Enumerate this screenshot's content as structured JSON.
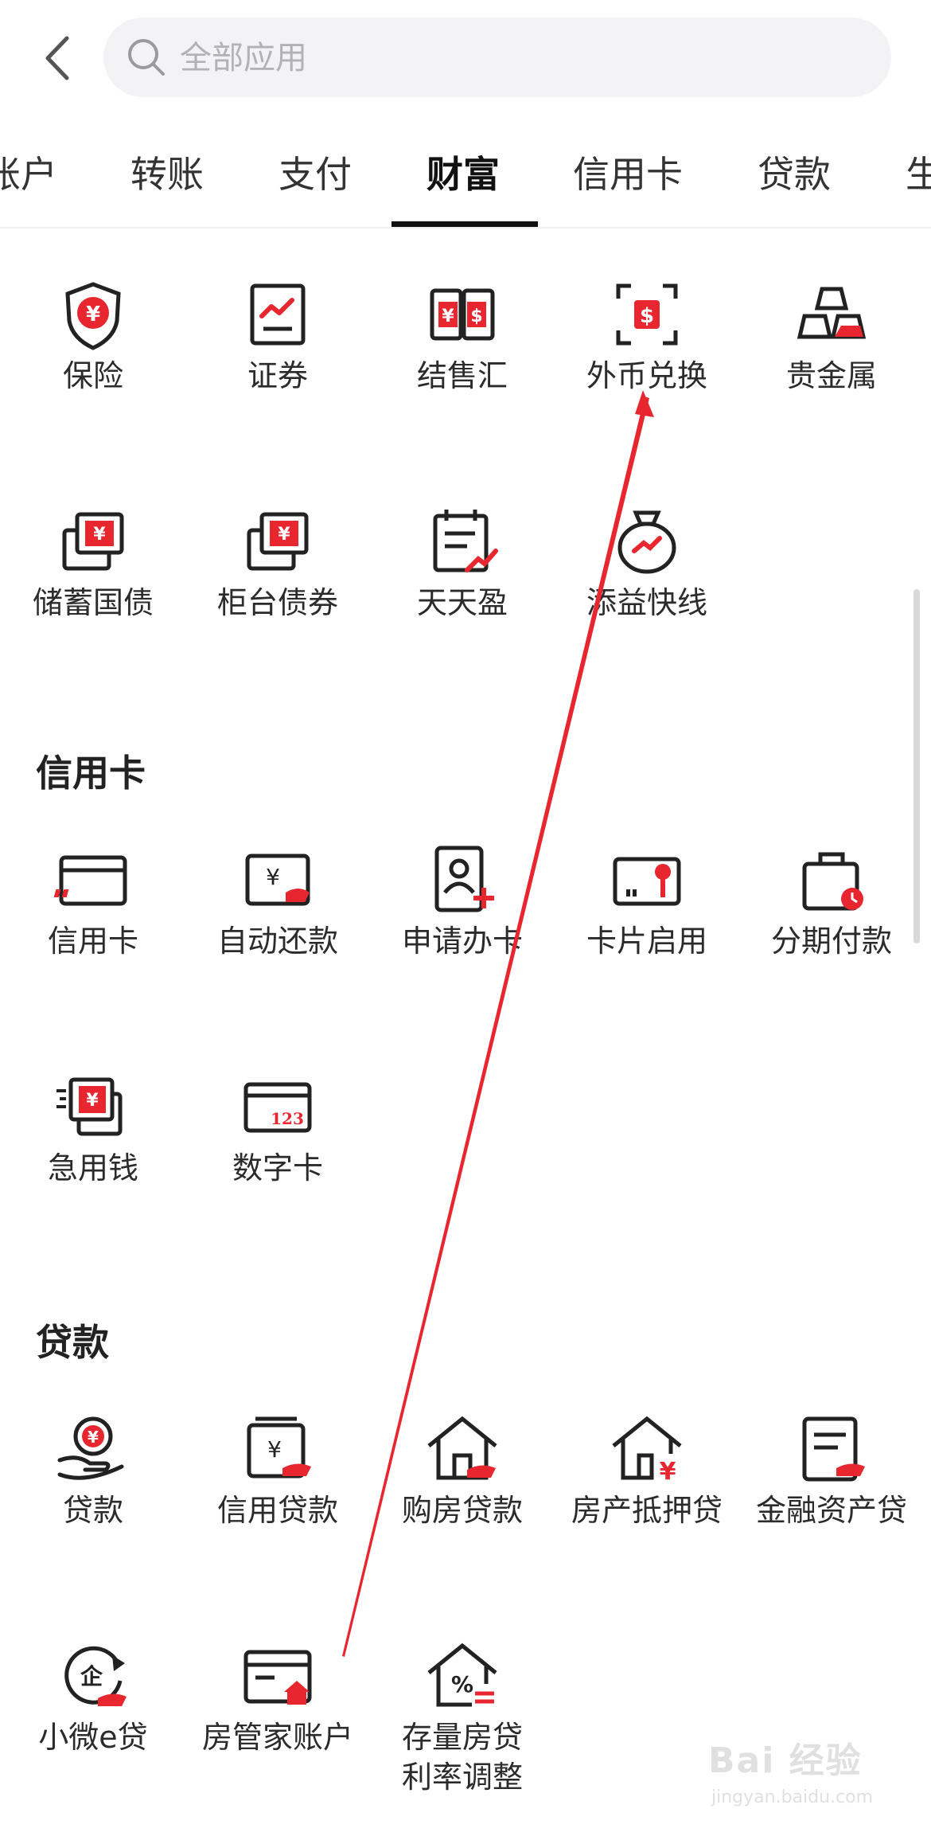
{
  "search": {
    "placeholder": "全部应用"
  },
  "tabs": [
    {
      "label": "账户"
    },
    {
      "label": "转账"
    },
    {
      "label": "支付"
    },
    {
      "label": "财富",
      "active": true
    },
    {
      "label": "信用卡"
    },
    {
      "label": "贷款"
    },
    {
      "label": "生"
    }
  ],
  "sections": {
    "wealth": {
      "items": [
        {
          "label": "保险",
          "icon": "shield-yuan-icon"
        },
        {
          "label": "证券",
          "icon": "stock-chart-icon"
        },
        {
          "label": "结售汇",
          "icon": "exchange-yuan-dollar-icon"
        },
        {
          "label": "外币兑换",
          "icon": "foreign-currency-scan-icon"
        },
        {
          "label": "贵金属",
          "icon": "gold-bars-icon"
        },
        {
          "label": "储蓄国债",
          "icon": "savings-bond-icon"
        },
        {
          "label": "柜台债券",
          "icon": "counter-bond-icon"
        },
        {
          "label": "天天盈",
          "icon": "calendar-growth-icon"
        },
        {
          "label": "添益快线",
          "icon": "money-bag-icon"
        }
      ]
    },
    "credit": {
      "title": "信用卡",
      "items": [
        {
          "label": "信用卡",
          "icon": "credit-card-icon"
        },
        {
          "label": "自动还款",
          "icon": "auto-repay-icon"
        },
        {
          "label": "申请办卡",
          "icon": "apply-card-icon"
        },
        {
          "label": "卡片启用",
          "icon": "card-activate-icon"
        },
        {
          "label": "分期付款",
          "icon": "installment-bag-icon"
        },
        {
          "label": "急用钱",
          "icon": "urgent-cash-icon"
        },
        {
          "label": "数字卡",
          "icon": "digital-card-icon"
        }
      ]
    },
    "loan": {
      "title": "贷款",
      "items": [
        {
          "label": "贷款",
          "icon": "loan-hand-icon"
        },
        {
          "label": "信用贷款",
          "icon": "credit-loan-icon"
        },
        {
          "label": "购房贷款",
          "icon": "home-loan-icon"
        },
        {
          "label": "房产抵押贷",
          "icon": "mortgage-house-icon"
        },
        {
          "label": "金融资产贷",
          "icon": "asset-loan-icon"
        },
        {
          "label": "小微e贷",
          "icon": "small-business-loan-icon"
        },
        {
          "label": "房管家账户",
          "icon": "house-account-icon"
        },
        {
          "label": "存量房贷",
          "label2": "利率调整",
          "icon": "rate-adjust-house-icon"
        }
      ]
    }
  },
  "watermark": {
    "text": "Bai 经验",
    "sub": "jingyan.baidu.com"
  },
  "colors": {
    "accent": "#e8262f",
    "text": "#2b2b2b",
    "line": "#222222"
  }
}
